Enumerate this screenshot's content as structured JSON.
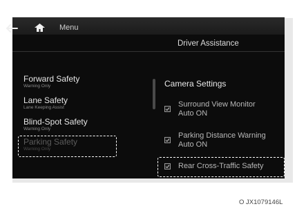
{
  "topbar": {
    "menu_label": "Menu"
  },
  "header": {
    "title": "Driver Assistance"
  },
  "left_menu": [
    {
      "label": "Forward Safety",
      "sub": "Warning Only"
    },
    {
      "label": "Lane Safety",
      "sub": "Lane Keeping Assist"
    },
    {
      "label": "Blind-Spot Safety",
      "sub": "Warning Only"
    },
    {
      "label": "Parking Safety",
      "sub": "Warning Only"
    }
  ],
  "camera_settings": {
    "title": "Camera Settings",
    "options": [
      {
        "line1": "Surround View Monitor",
        "line2": "Auto ON",
        "checked": true
      },
      {
        "line1": "Parking Distance Warning",
        "line2": "Auto ON",
        "checked": true
      },
      {
        "line1": "Rear Cross-Traffic Safety",
        "checked": true
      }
    ]
  },
  "caption": "O JX1079146L"
}
